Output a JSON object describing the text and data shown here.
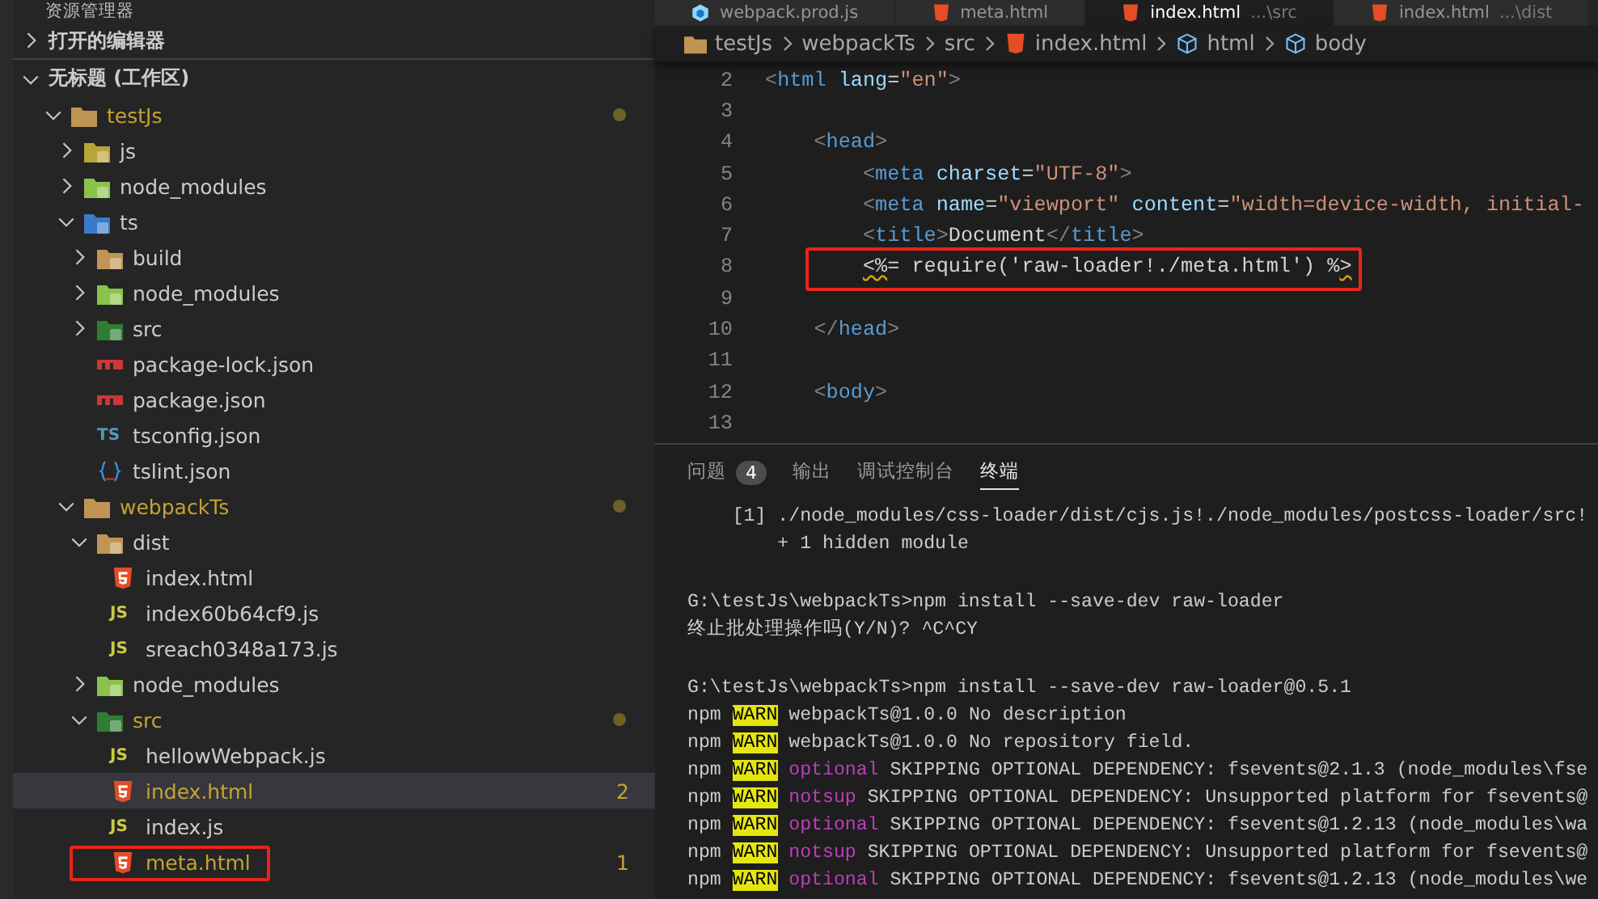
{
  "sidebar": {
    "header": "资源管理器",
    "sections": [
      {
        "label": "打开的编辑器",
        "expanded": false
      },
      {
        "label": "无标题 (工作区)",
        "expanded": true
      }
    ],
    "tree": [
      {
        "name": "testJs",
        "kind": "folder-open",
        "expanded": true,
        "modified": true,
        "selected": false,
        "boxed": false,
        "children": [
          {
            "name": "js",
            "kind": "folder-js",
            "expanded": false,
            "modified": false,
            "selected": false,
            "boxed": false
          },
          {
            "name": "node_modules",
            "kind": "folder-node",
            "expanded": false,
            "modified": false,
            "selected": false,
            "boxed": false
          },
          {
            "name": "ts",
            "kind": "folder-ts",
            "expanded": true,
            "modified": false,
            "selected": false,
            "boxed": false,
            "children": [
              {
                "name": "build",
                "kind": "folder-build",
                "expanded": false,
                "modified": false,
                "selected": false,
                "boxed": false
              },
              {
                "name": "node_modules",
                "kind": "folder-node",
                "expanded": false,
                "modified": false,
                "selected": false,
                "boxed": false
              },
              {
                "name": "src",
                "kind": "folder-src",
                "expanded": false,
                "modified": false,
                "selected": false,
                "boxed": false
              },
              {
                "name": "package-lock.json",
                "kind": "npm",
                "modified": false,
                "selected": false,
                "boxed": false
              },
              {
                "name": "package.json",
                "kind": "npm",
                "modified": false,
                "selected": false,
                "boxed": false
              },
              {
                "name": "tsconfig.json",
                "kind": "ts",
                "icon_label": "TS",
                "modified": false,
                "selected": false,
                "boxed": false
              },
              {
                "name": "tslint.json",
                "kind": "braces",
                "modified": false,
                "selected": false,
                "boxed": false
              }
            ]
          },
          {
            "name": "webpackTs",
            "kind": "folder-open",
            "expanded": true,
            "modified": true,
            "selected": false,
            "boxed": false,
            "children": [
              {
                "name": "dist",
                "kind": "folder-build",
                "expanded": true,
                "modified": false,
                "selected": false,
                "boxed": false,
                "children": [
                  {
                    "name": "index.html",
                    "kind": "html",
                    "modified": false,
                    "selected": false,
                    "boxed": false
                  },
                  {
                    "name": "index60b64cf9.js",
                    "kind": "js",
                    "icon_label": "JS",
                    "modified": false,
                    "selected": false,
                    "boxed": false
                  },
                  {
                    "name": "sreach0348a173.js",
                    "kind": "js",
                    "icon_label": "JS",
                    "modified": false,
                    "selected": false,
                    "boxed": false
                  }
                ]
              },
              {
                "name": "node_modules",
                "kind": "folder-node",
                "expanded": false,
                "modified": false,
                "selected": false,
                "boxed": false
              },
              {
                "name": "src",
                "kind": "folder-src",
                "expanded": true,
                "modified": true,
                "selected": false,
                "boxed": false,
                "children": [
                  {
                    "name": "hellowWebpack.js",
                    "kind": "js",
                    "icon_label": "JS",
                    "modified": false,
                    "selected": false,
                    "boxed": false
                  },
                  {
                    "name": "index.html",
                    "kind": "html",
                    "modified": true,
                    "badge": "2",
                    "selected": true,
                    "boxed": false
                  },
                  {
                    "name": "index.js",
                    "kind": "js",
                    "icon_label": "JS",
                    "modified": false,
                    "selected": false,
                    "boxed": false
                  },
                  {
                    "name": "meta.html",
                    "kind": "html",
                    "modified": true,
                    "badge": "1",
                    "selected": false,
                    "boxed": true
                  }
                ]
              }
            ]
          }
        ]
      }
    ]
  },
  "editor": {
    "tabs": [
      {
        "label": "webpack.prod.js",
        "kind": "webpack",
        "selected": false
      },
      {
        "label": "meta.html",
        "kind": "html",
        "selected": false
      },
      {
        "label": "index.html",
        "path": "...\\src",
        "kind": "html",
        "selected": true
      },
      {
        "label": "index.html",
        "path": "...\\dist",
        "kind": "html",
        "selected": false
      }
    ],
    "breadcrumb": [
      {
        "label": "testJs",
        "kind": "folder"
      },
      {
        "label": "webpackTs",
        "kind": "plain"
      },
      {
        "label": "src",
        "kind": "plain"
      },
      {
        "label": "index.html",
        "kind": "html"
      },
      {
        "label": "html",
        "kind": "element"
      },
      {
        "label": "body",
        "kind": "element"
      }
    ],
    "lines": [
      {
        "number": "2",
        "boxed": false,
        "tokens": [
          {
            "text": "<",
            "kind": "punct"
          },
          {
            "text": "html",
            "kind": "tag"
          },
          {
            "text": " lang",
            "kind": "attr"
          },
          {
            "text": "=",
            "kind": "text"
          },
          {
            "text": "\"en\"",
            "kind": "str"
          },
          {
            "text": ">",
            "kind": "punct"
          }
        ]
      },
      {
        "number": "3",
        "boxed": false
      },
      {
        "number": "4",
        "boxed": false,
        "tokens": [
          {
            "text": "    <",
            "kind": "punct"
          },
          {
            "text": "head",
            "kind": "tag"
          },
          {
            "text": ">",
            "kind": "punct"
          }
        ]
      },
      {
        "number": "5",
        "boxed": false,
        "tokens": [
          {
            "text": "        <",
            "kind": "punct"
          },
          {
            "text": "meta",
            "kind": "tag"
          },
          {
            "text": " charset",
            "kind": "attr"
          },
          {
            "text": "=",
            "kind": "text"
          },
          {
            "text": "\"UTF-8\"",
            "kind": "str"
          },
          {
            "text": ">",
            "kind": "punct"
          }
        ]
      },
      {
        "number": "6",
        "boxed": false,
        "tokens": [
          {
            "text": "        <",
            "kind": "punct"
          },
          {
            "text": "meta",
            "kind": "tag"
          },
          {
            "text": " name",
            "kind": "attr"
          },
          {
            "text": "=",
            "kind": "text"
          },
          {
            "text": "\"viewport\"",
            "kind": "str"
          },
          {
            "text": " content",
            "kind": "attr"
          },
          {
            "text": "=",
            "kind": "text"
          },
          {
            "text": "\"width=device-width, initial-",
            "kind": "str"
          }
        ]
      },
      {
        "number": "7",
        "boxed": false,
        "tokens": [
          {
            "text": "        <",
            "kind": "punct"
          },
          {
            "text": "title",
            "kind": "tag"
          },
          {
            "text": ">",
            "kind": "punct"
          },
          {
            "text": "Document",
            "kind": "text"
          },
          {
            "text": "</",
            "kind": "punct"
          },
          {
            "text": "title",
            "kind": "tag"
          },
          {
            "text": ">",
            "kind": "punct"
          }
        ]
      },
      {
        "number": "8",
        "boxed": true,
        "tokens": [
          {
            "text": "        <%",
            "kind": "warn"
          },
          {
            "text": "= require('raw-loader!./meta.html') %",
            "kind": "text"
          },
          {
            "text": ">",
            "kind": "warn"
          }
        ]
      },
      {
        "number": "9",
        "boxed": false
      },
      {
        "number": "10",
        "boxed": false,
        "tokens": [
          {
            "text": "    </",
            "kind": "punct"
          },
          {
            "text": "head",
            "kind": "tag"
          },
          {
            "text": ">",
            "kind": "punct"
          }
        ]
      },
      {
        "number": "11",
        "boxed": false
      },
      {
        "number": "12",
        "boxed": false,
        "tokens": [
          {
            "text": "    <",
            "kind": "punct"
          },
          {
            "text": "body",
            "kind": "tag"
          },
          {
            "text": ">",
            "kind": "punct"
          }
        ]
      },
      {
        "number": "13",
        "boxed": false
      }
    ]
  },
  "panel": {
    "tabs": [
      {
        "label": "问题",
        "badge": "4",
        "selected": false
      },
      {
        "label": "输出",
        "selected": false
      },
      {
        "label": "调试控制台",
        "selected": false
      },
      {
        "label": "终端",
        "selected": true
      }
    ],
    "terminal": [
      {
        "segments": [
          {
            "text": "    [1] ./node_modules/css-loader/dist/cjs.js!./node_modules/postcss-loader/src!",
            "kind": "plain"
          }
        ]
      },
      {
        "segments": [
          {
            "text": "        + 1 hidden module",
            "kind": "plain"
          }
        ]
      },
      {
        "kind": "blank"
      },
      {
        "segments": [
          {
            "text": "G:\\testJs\\webpackTs>npm install --save-dev raw-loader",
            "kind": "plain"
          }
        ]
      },
      {
        "segments": [
          {
            "text": "终止批处理操作吗(Y/N)? ^C^CY",
            "kind": "plain"
          }
        ]
      },
      {
        "kind": "blank"
      },
      {
        "segments": [
          {
            "text": "G:\\testJs\\webpackTs>npm install --save-dev raw-loader@0.5.1",
            "kind": "plain"
          }
        ]
      },
      {
        "segments": [
          {
            "text": "npm ",
            "kind": "plain"
          },
          {
            "text": "WARN",
            "kind": "warn"
          },
          {
            "text": " webpackTs@1.0.0 No description",
            "kind": "plain"
          }
        ]
      },
      {
        "segments": [
          {
            "text": "npm ",
            "kind": "plain"
          },
          {
            "text": "WARN",
            "kind": "warn"
          },
          {
            "text": " webpackTs@1.0.0 No repository field.",
            "kind": "plain"
          }
        ]
      },
      {
        "segments": [
          {
            "text": "npm ",
            "kind": "plain"
          },
          {
            "text": "WARN",
            "kind": "warn"
          },
          {
            "text": " optional",
            "kind": "tag"
          },
          {
            "text": " SKIPPING OPTIONAL DEPENDENCY: fsevents@2.1.3 (node_modules\\fse",
            "kind": "plain"
          }
        ]
      },
      {
        "segments": [
          {
            "text": "npm ",
            "kind": "plain"
          },
          {
            "text": "WARN",
            "kind": "warn"
          },
          {
            "text": " notsup",
            "kind": "tag"
          },
          {
            "text": " SKIPPING OPTIONAL DEPENDENCY: Unsupported platform for fsevents@",
            "kind": "plain"
          }
        ]
      },
      {
        "segments": [
          {
            "text": "npm ",
            "kind": "plain"
          },
          {
            "text": "WARN",
            "kind": "warn"
          },
          {
            "text": " optional",
            "kind": "tag"
          },
          {
            "text": " SKIPPING OPTIONAL DEPENDENCY: fsevents@1.2.13 (node_modules\\wa",
            "kind": "plain"
          }
        ]
      },
      {
        "segments": [
          {
            "text": "npm ",
            "kind": "plain"
          },
          {
            "text": "WARN",
            "kind": "warn"
          },
          {
            "text": " notsup",
            "kind": "tag"
          },
          {
            "text": " SKIPPING OPTIONAL DEPENDENCY: Unsupported platform for fsevents@",
            "kind": "plain"
          }
        ]
      },
      {
        "segments": [
          {
            "text": "npm ",
            "kind": "plain"
          },
          {
            "text": "WARN",
            "kind": "warn"
          },
          {
            "text": " optional",
            "kind": "tag"
          },
          {
            "text": " SKIPPING OPTIONAL DEPENDENCY: fsevents@1.2.13 (node_modules\\we",
            "kind": "plain"
          }
        ]
      }
    ]
  }
}
